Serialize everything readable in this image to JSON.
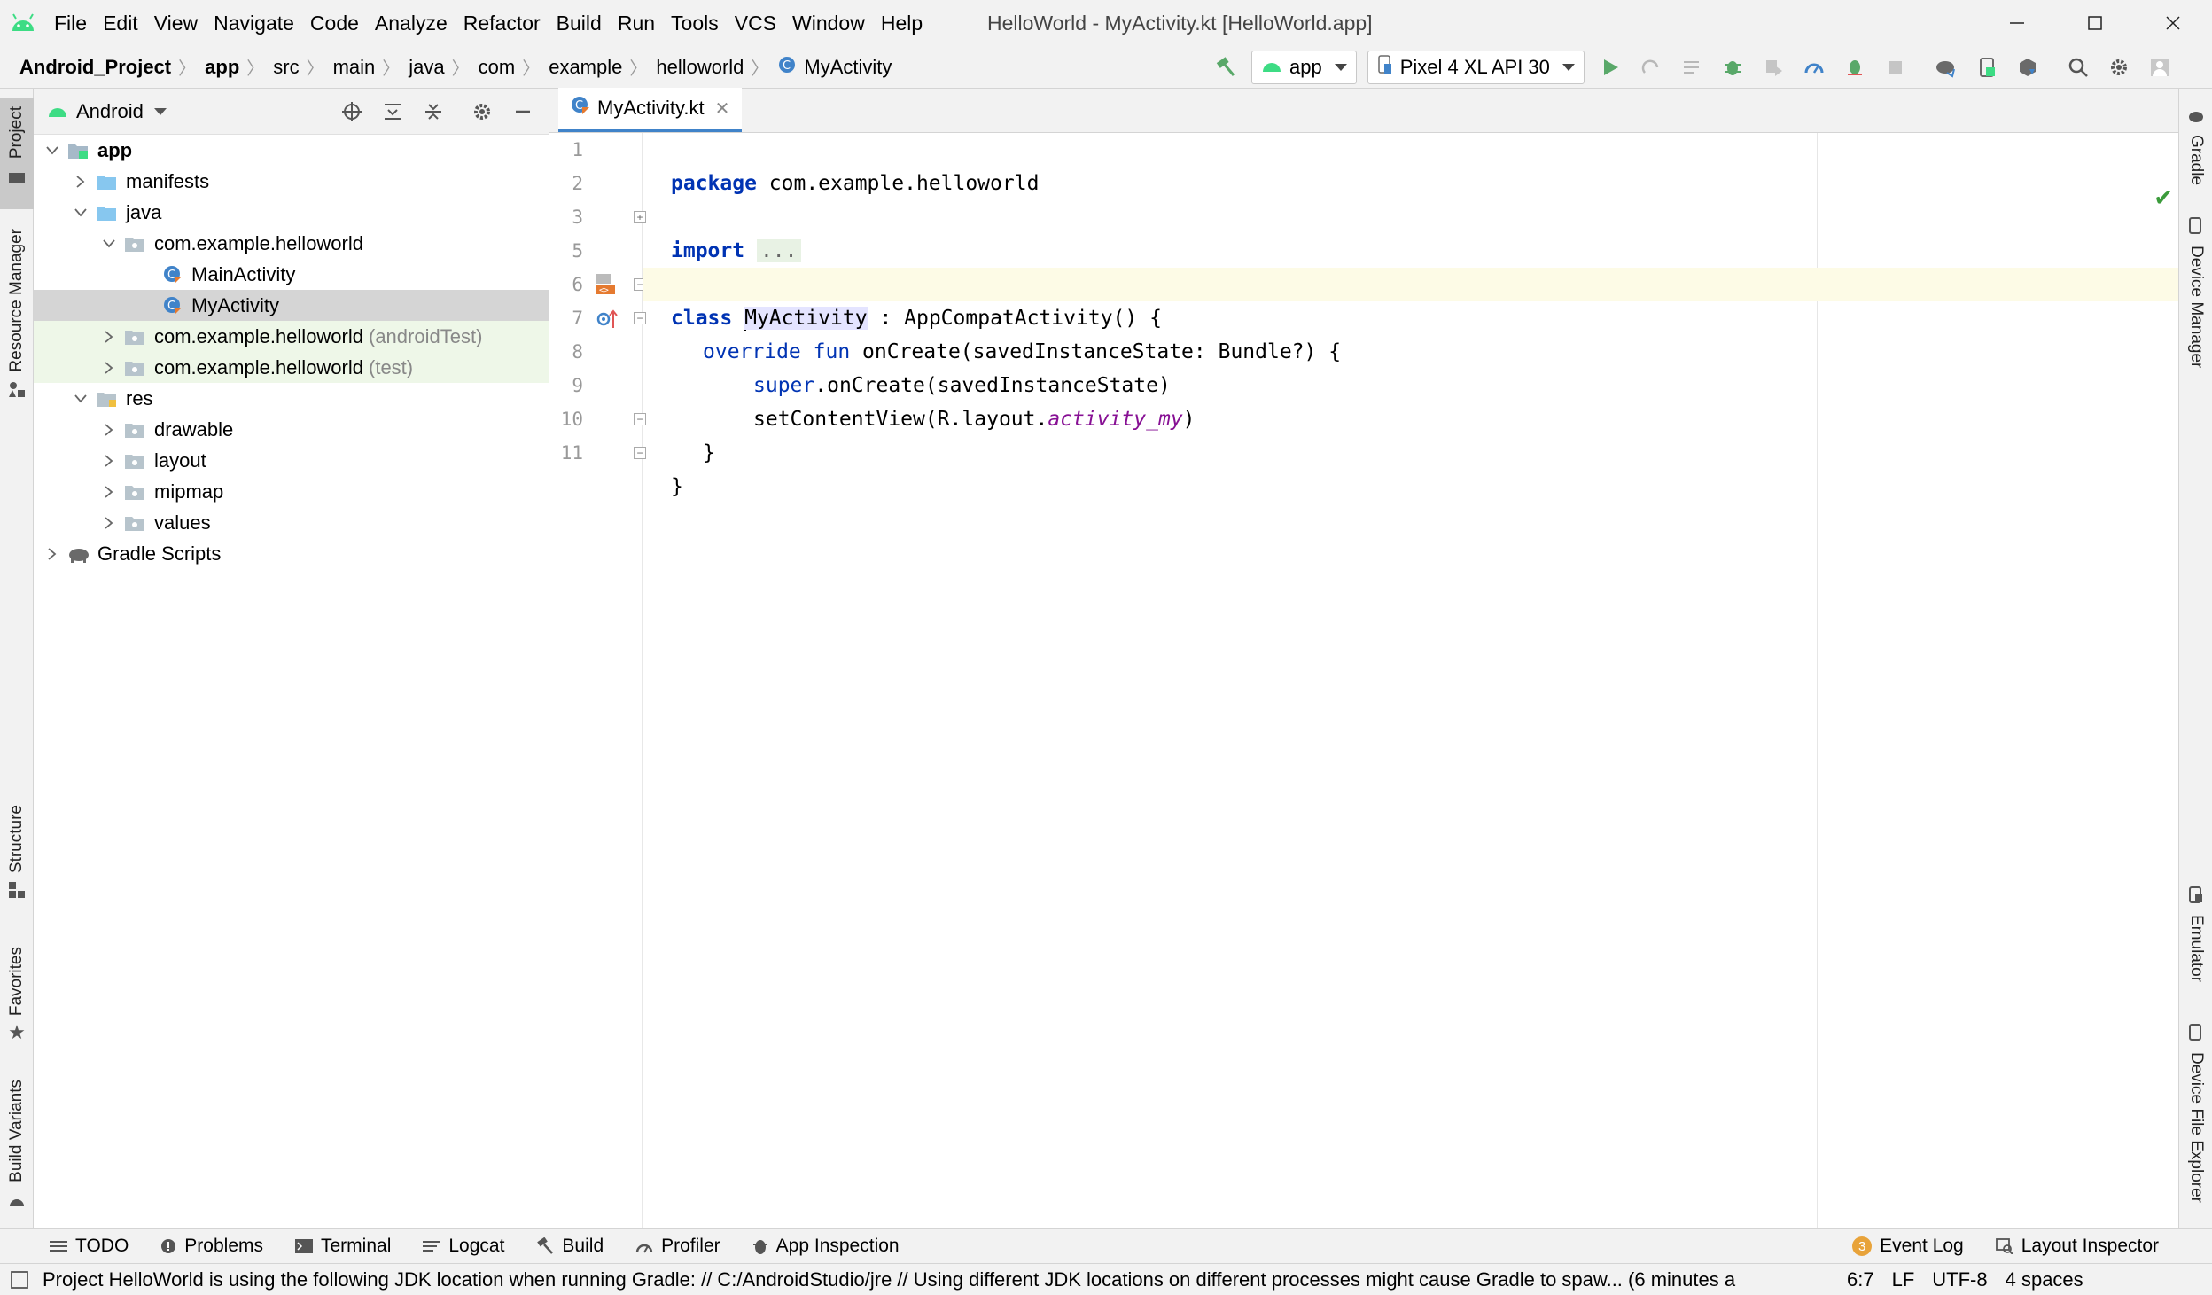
{
  "window": {
    "title": "HelloWorld - MyActivity.kt [HelloWorld.app]",
    "minimize_icon": "minimize-icon",
    "maximize_icon": "maximize-icon",
    "close_icon": "close-icon"
  },
  "menu": [
    "File",
    "Edit",
    "View",
    "Navigate",
    "Code",
    "Analyze",
    "Refactor",
    "Build",
    "Run",
    "Tools",
    "VCS",
    "Window",
    "Help"
  ],
  "breadcrumbs": [
    "Android_Project",
    "app",
    "src",
    "main",
    "java",
    "com",
    "example",
    "helloworld",
    "MyActivity"
  ],
  "toolbar": {
    "run_config": "app",
    "device": "Pixel 4 XL API 30"
  },
  "left_tool_tabs": [
    "Project",
    "Resource Manager",
    "Structure",
    "Favorites",
    "Build Variants"
  ],
  "right_tool_tabs": [
    "Gradle",
    "Device Manager",
    "Emulator",
    "Device File Explorer"
  ],
  "project_panel": {
    "view": "Android",
    "tree": [
      {
        "label": "app",
        "extra": ""
      },
      {
        "label": "manifests",
        "extra": ""
      },
      {
        "label": "java",
        "extra": ""
      },
      {
        "label": "com.example.helloworld",
        "extra": ""
      },
      {
        "label": "MainActivity",
        "extra": ""
      },
      {
        "label": "MyActivity",
        "extra": ""
      },
      {
        "label": "com.example.helloworld",
        "extra": "(androidTest)"
      },
      {
        "label": "com.example.helloworld",
        "extra": "(test)"
      },
      {
        "label": "res",
        "extra": ""
      },
      {
        "label": "drawable",
        "extra": ""
      },
      {
        "label": "layout",
        "extra": ""
      },
      {
        "label": "mipmap",
        "extra": ""
      },
      {
        "label": "values",
        "extra": ""
      },
      {
        "label": "Gradle Scripts",
        "extra": ""
      }
    ]
  },
  "editor": {
    "tab": "MyActivity.kt",
    "line_numbers": [
      "1",
      "2",
      "3",
      "5",
      "6",
      "7",
      "8",
      "9",
      "10",
      "11"
    ],
    "code": {
      "l1_kw": "package",
      "l1_rest": " com.example.helloworld",
      "l3_kw": "import",
      "l3_fold": "...",
      "l6_kw": "class",
      "l6_ident": "MyActivity",
      "l6_rest": " : AppCompatActivity() {",
      "l7_kw1": "override",
      "l7_kw2": "fun",
      "l7_rest": " onCreate(savedInstanceState: Bundle?) {",
      "l8_kw": "super",
      "l8_rest": ".onCreate(savedInstanceState)",
      "l9_pre": "setContentView(R.layout.",
      "l9_ident": "activity_my",
      "l9_post": ")",
      "l10": "}",
      "l11": "}"
    }
  },
  "bottom_tools": [
    "TODO",
    "Problems",
    "Terminal",
    "Logcat",
    "Build",
    "Profiler",
    "App Inspection"
  ],
  "bottom_right_tools": {
    "event_log": "Event Log",
    "event_count": "3",
    "layout_inspector": "Layout Inspector"
  },
  "status": {
    "message": "Project HelloWorld is using the following JDK location when running Gradle: // C:/AndroidStudio/jre // Using different JDK locations on different processes might cause Gradle to spaw... (6 minutes a",
    "position": "6:7",
    "line_sep": "LF",
    "encoding": "UTF-8",
    "indent": "4 spaces"
  },
  "colors": {
    "android_green": "#3ddc84",
    "keyword_blue": "#0033b3",
    "purple_italic": "#871094",
    "selection": "#d5d5d5",
    "current_line": "#fdfbe6"
  }
}
